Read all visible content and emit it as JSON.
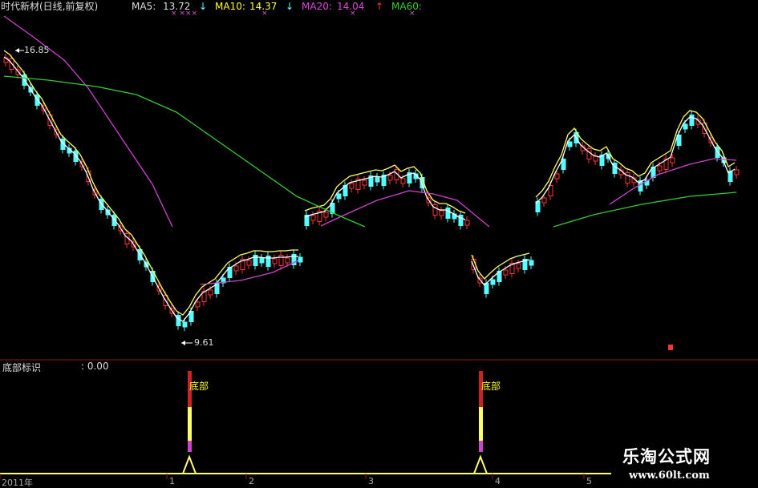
{
  "header": {
    "stock_title": "时代新材(日线,前复权)",
    "ma5_label": "MA5:",
    "ma5_value": "13.72",
    "ma5_arrow": "↓",
    "ma10_label": "MA10:",
    "ma10_value": "14.37",
    "ma10_arrow": "↓",
    "ma20_label": "MA20:",
    "ma20_value": "14.04",
    "ma20_arrow": "↑",
    "ma60_label": "MA60:",
    "ma5_marks": "×  ×××",
    "ma10_mark": "×",
    "ma20_mark": "×",
    "ma60_mark": "×"
  },
  "price_panel": {
    "high_label": "16.85",
    "low_label": "9.61"
  },
  "indicator_panel": {
    "title": "底部标识",
    "value": ": 0.00",
    "signal_label": "底部"
  },
  "time_axis": {
    "year_label": "2011年",
    "ticks": [
      "1",
      "2",
      "3",
      "4",
      "5"
    ]
  },
  "watermark": {
    "site_name": "乐淘公式网",
    "url": "www.60lt.com"
  },
  "chart_data": {
    "type": "candlestick",
    "title": "时代新材(日线,前复权)",
    "x_label": "2011年",
    "x_ticks": [
      "1",
      "2",
      "3",
      "4",
      "5"
    ],
    "moving_averages": [
      {
        "name": "MA5",
        "value": 13.72,
        "color": "#ffffff"
      },
      {
        "name": "MA10",
        "value": 14.37,
        "color": "#ffff66"
      },
      {
        "name": "MA20",
        "value": 14.04,
        "color": "#cc44cc"
      },
      {
        "name": "MA60",
        "value": null,
        "color": "#33cc33"
      }
    ],
    "price_high": 16.85,
    "price_low": 9.61,
    "indicator": {
      "name": "底部标识",
      "value": 0.0,
      "signals": [
        {
          "label": "底部",
          "tick": "1"
        },
        {
          "label": "底部",
          "tick": "4"
        }
      ]
    },
    "colors": {
      "up": "#ff3333",
      "down": "#55ffff",
      "background": "#000000"
    }
  }
}
